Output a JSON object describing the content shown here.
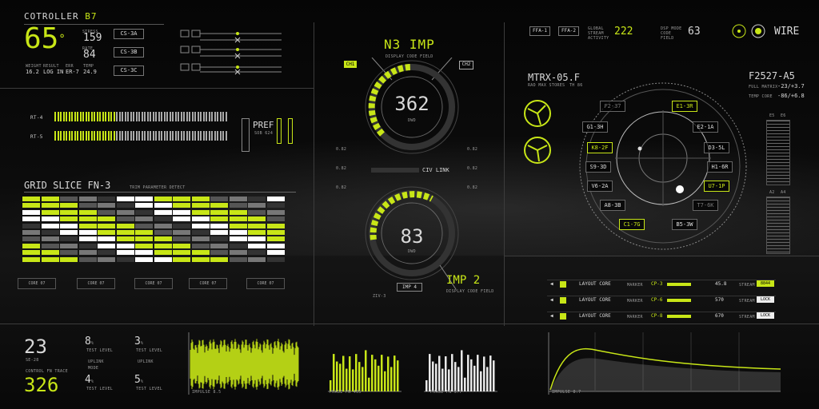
{
  "controller": {
    "title": "COTROLLER",
    "title_code": "B7",
    "big_value": "65",
    "big_unit": "°",
    "val1_label": "STRESS",
    "val1": "159",
    "val2_label": "RATE",
    "val2": "84",
    "stats": [
      {
        "label": "WEIGHT",
        "value": "16.2"
      },
      {
        "label": "RESULT",
        "value": "LOG IN"
      },
      {
        "label": "ERR",
        "value": "ER-7"
      },
      {
        "label": "TEMP",
        "value": "24.9"
      }
    ],
    "cs_buttons": [
      "CS-3A",
      "CS-3B",
      "CS-3C"
    ]
  },
  "rt_rows": [
    "RT-4",
    "RT-5"
  ],
  "pref": {
    "label": "PREF",
    "sub": "SOB 624"
  },
  "grid": {
    "title": "GRID SLICE FN-3",
    "sub": "TRIM PARAMETER DETECT",
    "cores": [
      "CORE 07",
      "CORE 07",
      "CORE 07",
      "CORE 07",
      "CORE 07"
    ]
  },
  "imp": {
    "title": "N3 IMP",
    "sub": "DISPLAY CODE FIELD",
    "ch1": "CH1",
    "ch2": "CH2",
    "gauge1_value": "362",
    "gauge1_unit": "DWD",
    "gauge2_value": "83",
    "gauge2_unit": "DWD",
    "civ_link": "CIV LINK",
    "side_labels": [
      "0.82",
      "0.82",
      "0.82",
      "0.82",
      "0.82",
      "0.82"
    ],
    "imp2": "IMP 2",
    "imp2_sub": "DISPLAY CODE FIELD",
    "bottom_btn": "IMP 4",
    "bottom_code": "ZIV-3"
  },
  "top_right": {
    "ffa1": "FFA-1",
    "ffa2": "FFA-2",
    "global_label": "GLOBAL STREAM ACTIVITY",
    "global_value": "222",
    "side_code": "DSP MODE CODE FIELD",
    "big": "63",
    "wire": "WIRE"
  },
  "matrix": {
    "title": "MTRX-05.F",
    "sub": "RAD MAX STORES",
    "sub2": "TH 86"
  },
  "f_panel": {
    "title": "F2527-A5",
    "l1": "FULL MATRIX",
    "v1": "-23/+3.7",
    "l2": "TEMP CORE",
    "v2": "-86/+6.8",
    "e_label": "E5",
    "e_val": "E6",
    "a_label": "A2",
    "a_val": "A4"
  },
  "radar_labels": [
    {
      "text": "F2-37",
      "hl": false,
      "dim": true
    },
    {
      "text": "E1-3R",
      "hl": true
    },
    {
      "text": "G1-3H",
      "hl": false
    },
    {
      "text": "E2-1A",
      "hl": false
    },
    {
      "text": "K8-2F",
      "hl": true
    },
    {
      "text": "D3-5L",
      "hl": false
    },
    {
      "text": "S9-3D",
      "hl": false
    },
    {
      "text": "H1-6R",
      "hl": false
    },
    {
      "text": "V6-2A",
      "hl": false
    },
    {
      "text": "U7-1P",
      "hl": true
    },
    {
      "text": "A8-3B",
      "hl": false
    },
    {
      "text": "T7-6K",
      "hl": false,
      "dim": true
    },
    {
      "text": "C1-7G",
      "hl": true
    },
    {
      "text": "B5-3W",
      "hl": false
    }
  ],
  "layout_core": [
    {
      "label": "LAYOUT CORE",
      "tag": "MARKER",
      "cp": "CP-3",
      "value": "45.8",
      "stream": "STREAM",
      "end": "8844"
    },
    {
      "label": "LAYOUT CORE",
      "tag": "MARKER",
      "cp": "CP-6",
      "value": "570",
      "stream": "STREAM",
      "end": "LOCK"
    },
    {
      "label": "LAYOUT CORE",
      "tag": "MARKER",
      "cp": "CP-8",
      "value": "670",
      "stream": "STREAM",
      "end": "LOCK"
    }
  ],
  "bottom_left": {
    "v1": "23",
    "v1_sub": "SE-28",
    "trace": "CONTROL FN TRACE",
    "v2": "326",
    "p1": "8",
    "p1_label": "TEST LEVEL",
    "p2": "3",
    "p2_label": "TEST LEVEL",
    "p3": "4",
    "p3_label": "TEST LEVEL",
    "p4": "5",
    "p4_label": "TEST LEVEL",
    "mid1": "UPLINK",
    "mid2": "MODE",
    "mid3": "UPLINK"
  },
  "bottom_charts": {
    "wave_label": "IMPULSE 8.5",
    "bar1_label": "PHASE FN 405",
    "bar2_label": "PHASE FN 3.7",
    "curve_label": "IMPULSE 8.7"
  },
  "colors": {
    "accent": "#c8e617",
    "text": "#d8d8d8",
    "dim": "#777777"
  }
}
